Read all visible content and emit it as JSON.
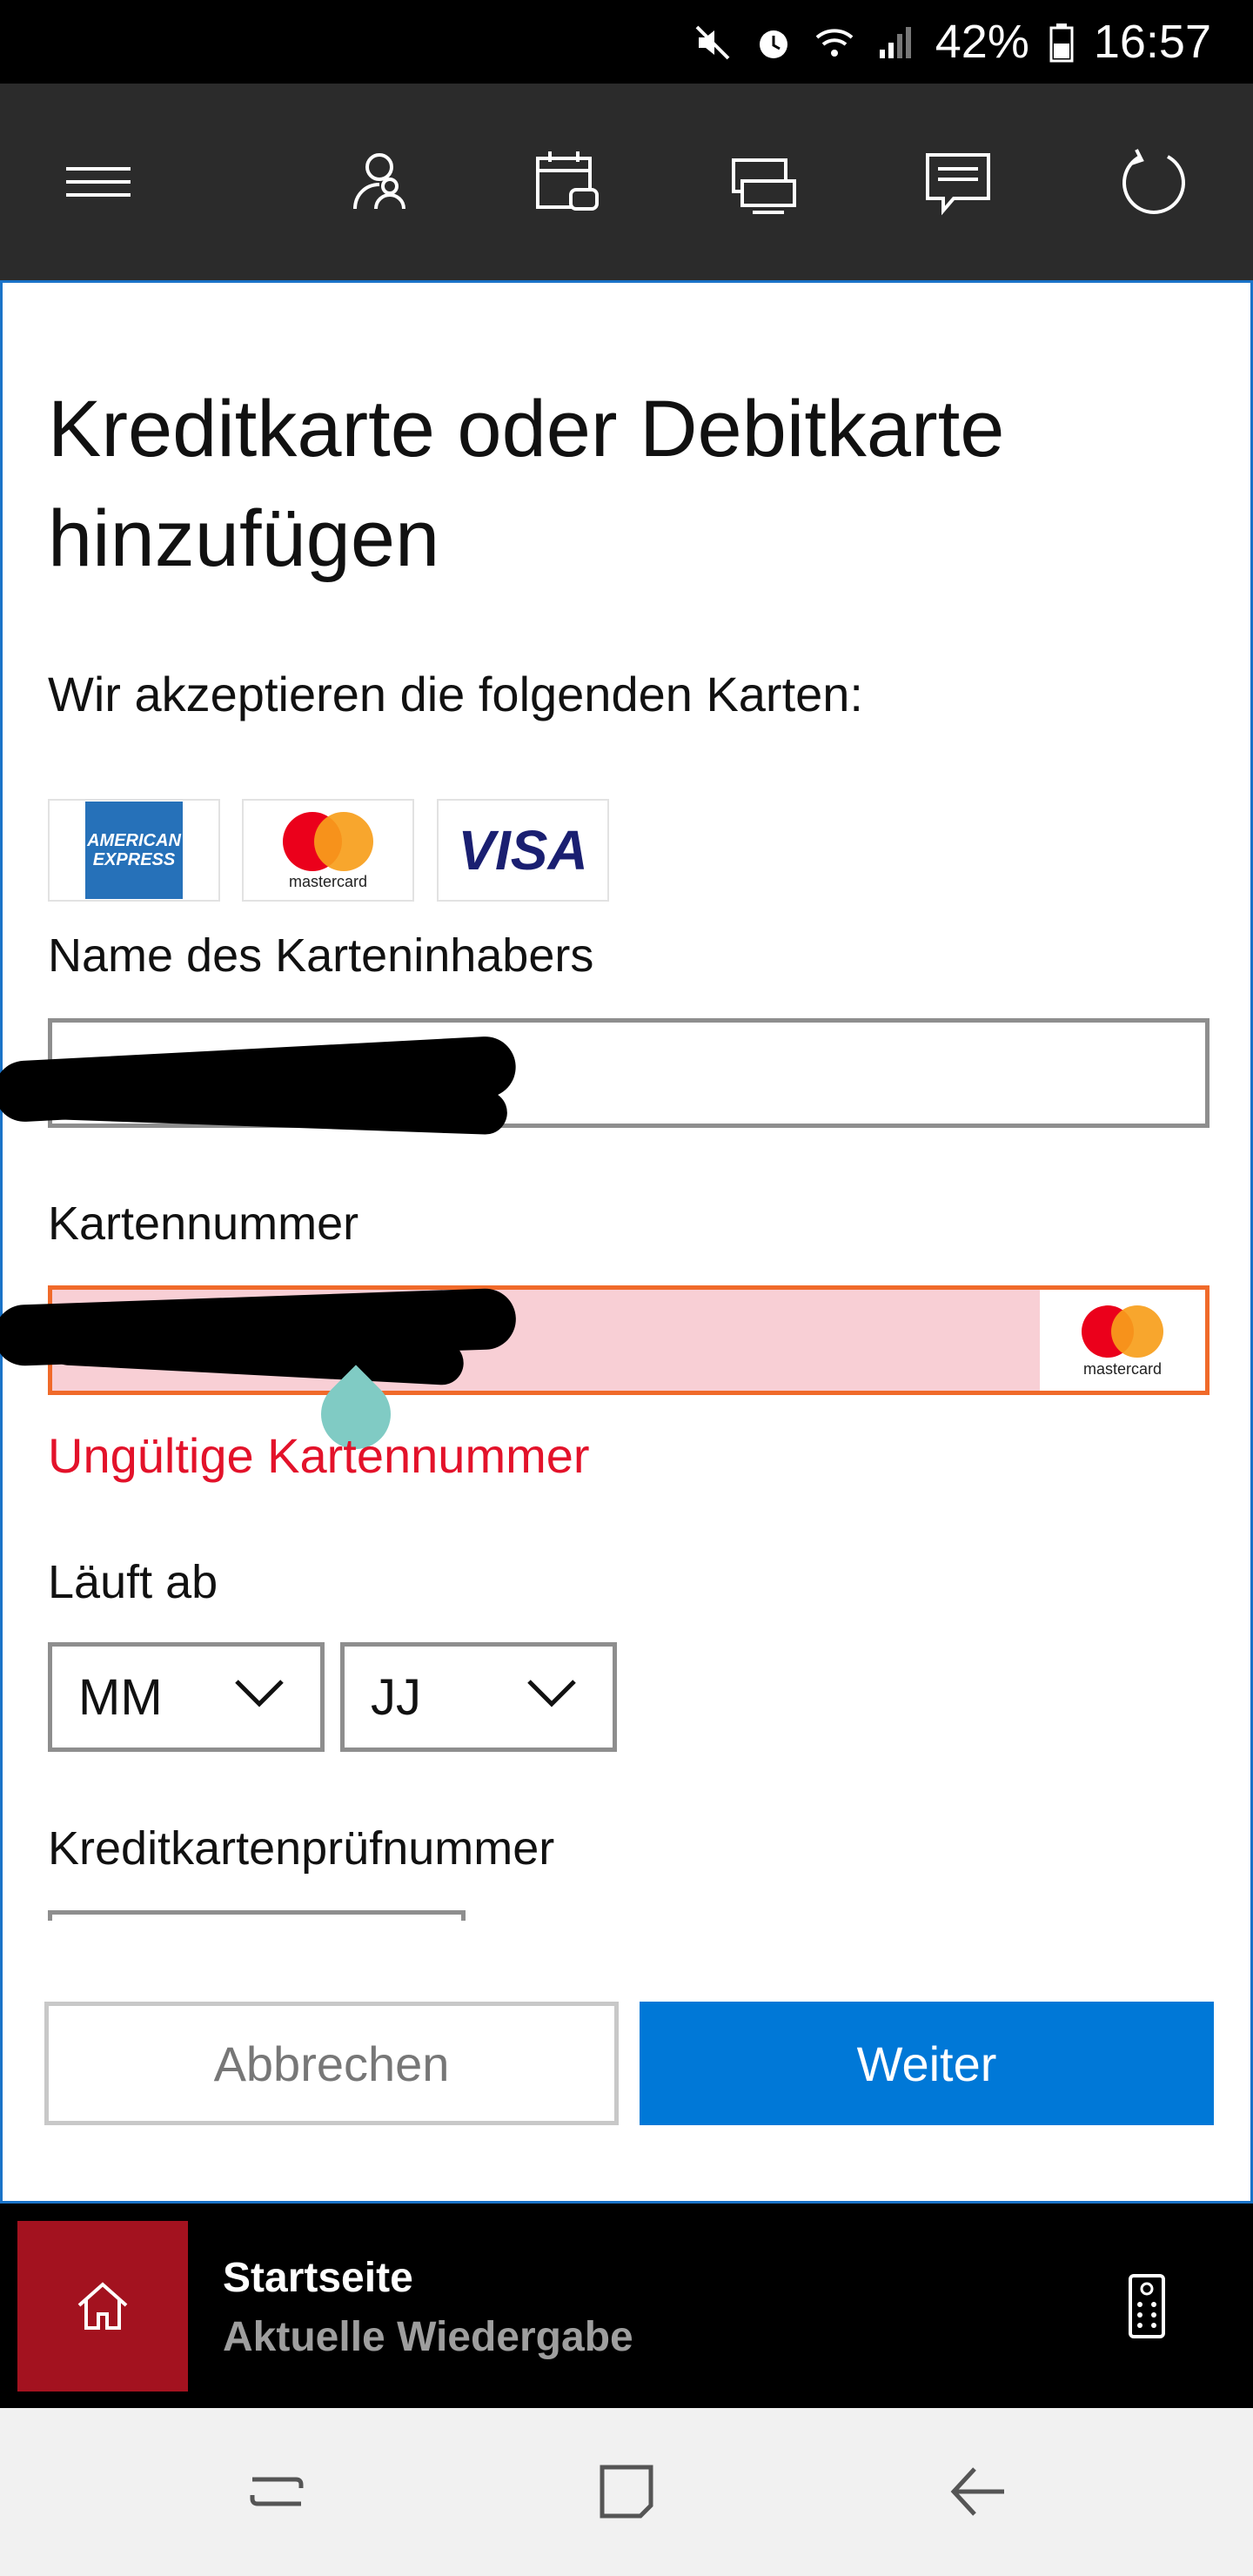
{
  "status_bar": {
    "battery_percent": "42%",
    "time": "16:57",
    "icons": [
      "mute-icon",
      "alarm-icon",
      "wifi-icon",
      "signal-icon",
      "battery-icon"
    ]
  },
  "app_bar": {
    "icons": [
      "menu-icon",
      "people-icon",
      "calendar-icon",
      "devices-icon",
      "messages-icon",
      "refresh-icon"
    ]
  },
  "form": {
    "title": "Kreditkarte oder Debitkarte hinzufügen",
    "accepted_label": "Wir akzeptieren die folgenden Karten:",
    "accepted_cards": {
      "amex_line1": "AMERICAN",
      "amex_line2": "EXPRESS",
      "mastercard": "mastercard",
      "visa": "VISA"
    },
    "cardholder_label": "Name des Karteninhabers",
    "card_number_label": "Kartennummer",
    "card_number_brand": "mastercard",
    "card_number_error": "Ungültige Kartennummer",
    "expiry_label": "Läuft ab",
    "expiry_month": "MM",
    "expiry_year": "JJ",
    "cvv_label": "Kreditkartenprüfnummer",
    "cancel_button": "Abbrechen",
    "next_button": "Weiter"
  },
  "player": {
    "title": "Startseite",
    "subtitle": "Aktuelle Wiedergabe"
  },
  "colors": {
    "primary": "#0078d7",
    "error": "#e3122a",
    "home_tile": "#a3121f",
    "invalid_field_bg": "#f8cfd5"
  }
}
